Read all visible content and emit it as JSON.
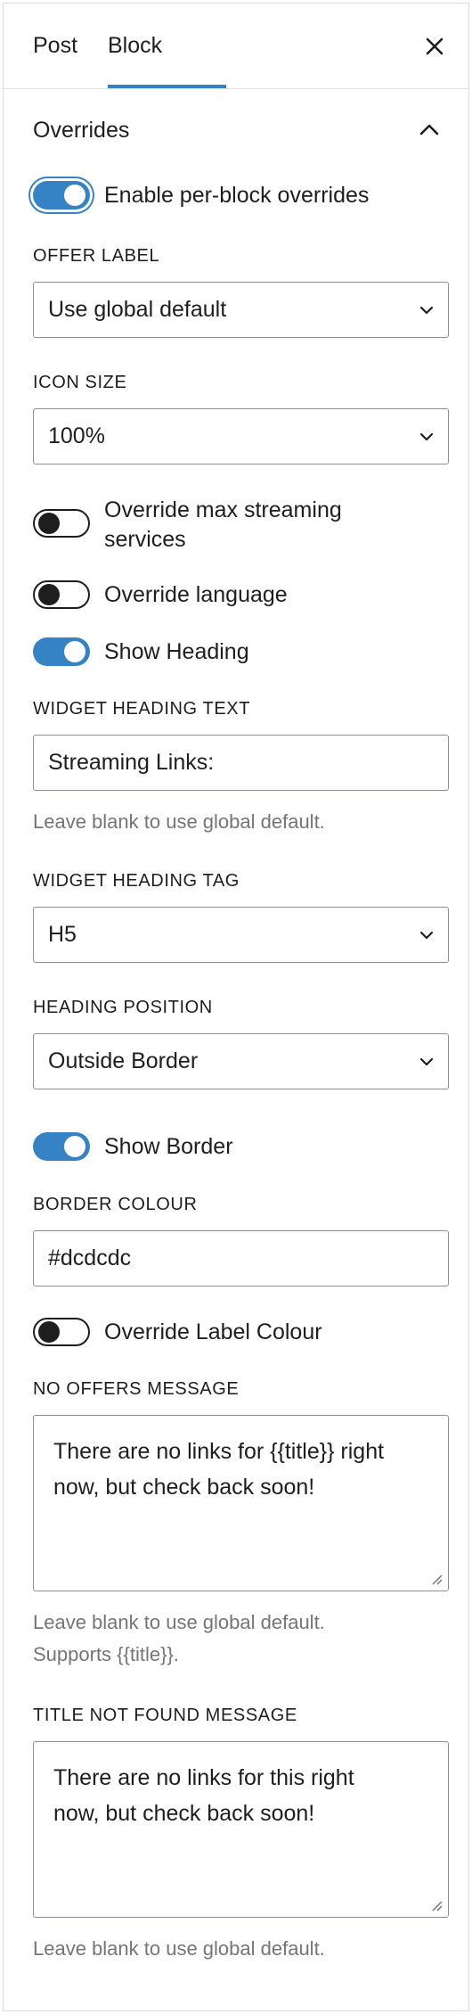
{
  "tabs": {
    "post": "Post",
    "block": "Block"
  },
  "section": {
    "title": "Overrides"
  },
  "toggles": {
    "enable_overrides": {
      "label": "Enable per-block overrides",
      "on": true
    },
    "override_max_streaming": {
      "label_line1": "Override max streaming",
      "label_line2": "services",
      "on": false
    },
    "override_language": {
      "label": "Override language",
      "on": false
    },
    "show_heading": {
      "label": "Show Heading",
      "on": true
    },
    "show_border": {
      "label": "Show Border",
      "on": true
    },
    "override_label_colour": {
      "label": "Override Label Colour",
      "on": false
    }
  },
  "fields": {
    "offer_label": {
      "label": "OFFER LABEL",
      "value": "Use global default"
    },
    "icon_size": {
      "label": "ICON SIZE",
      "value": "100%"
    },
    "widget_heading_text": {
      "label": "WIDGET HEADING TEXT",
      "value": "Streaming Links:",
      "help": "Leave blank to use global default."
    },
    "widget_heading_tag": {
      "label": "WIDGET HEADING TAG",
      "value": "H5"
    },
    "heading_position": {
      "label": "HEADING POSITION",
      "value": "Outside Border"
    },
    "border_colour": {
      "label": "BORDER COLOUR",
      "value": "#dcdcdc"
    },
    "no_offers_message": {
      "label": "NO OFFERS MESSAGE",
      "value_line1": "There are no links for {{title}} right",
      "value_line2": "now, but check back soon!",
      "help_line1": "Leave blank to use global default.",
      "help_line2": "Supports {{title}}."
    },
    "title_not_found_message": {
      "label": "TITLE NOT FOUND MESSAGE",
      "value_line1": "There are no links for this right",
      "value_line2": "now, but check back soon!",
      "help": "Leave blank to use global default."
    }
  },
  "colors": {
    "accent": "#3582c4",
    "border": "#8c8f94",
    "help_text": "#757575"
  }
}
